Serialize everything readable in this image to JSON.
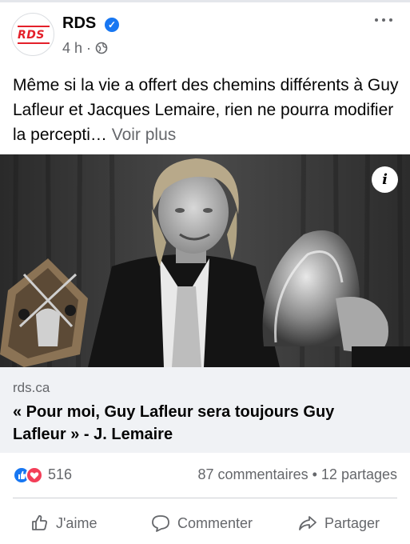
{
  "post": {
    "page_name": "RDS",
    "avatar_text": "RDS",
    "time": "4 h",
    "separator": "·",
    "text": "Même si la vie a offert des chemins différents à Guy Lafleur et Jacques Lemaire, rien ne pourra modifier la percepti…",
    "see_more": "Voir plus"
  },
  "link": {
    "domain": "rds.ca",
    "title": "« Pour moi, Guy Lafleur sera toujours Guy Lafleur » - J. Lemaire"
  },
  "stats": {
    "reaction_count": "516",
    "comments": "87 commentaires",
    "dot": "•",
    "shares": "12 partages"
  },
  "actions": {
    "like": "J'aime",
    "comment": "Commenter",
    "share": "Partager"
  },
  "icons": {
    "verified": "verified-check-icon",
    "globe": "globe-icon",
    "more": "more-options-icon",
    "info": "info-icon",
    "like_reaction": "like-reaction-icon",
    "love_reaction": "love-reaction-icon",
    "thumb": "thumbs-up-icon",
    "comment": "comment-bubble-icon",
    "share": "share-arrow-icon"
  },
  "colors": {
    "brand_blue": "#1877f2",
    "love_red": "#f33e58",
    "rds_red": "#e4202a",
    "secondary_text": "#65676b",
    "card_bg": "#f0f2f5"
  }
}
